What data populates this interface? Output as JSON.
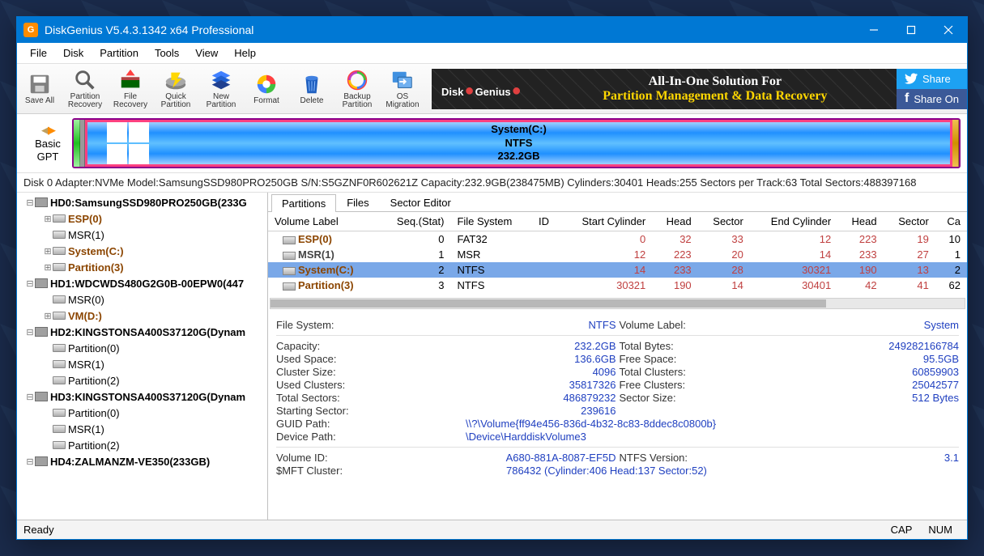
{
  "title": "DiskGenius V5.4.3.1342 x64 Professional",
  "menus": [
    "File",
    "Disk",
    "Partition",
    "Tools",
    "View",
    "Help"
  ],
  "toolbar_buttons": [
    {
      "name": "save-all",
      "label": "Save All"
    },
    {
      "name": "partition-recovery",
      "label": "Partition\nRecovery"
    },
    {
      "name": "file-recovery",
      "label": "File\nRecovery"
    },
    {
      "name": "quick-partition",
      "label": "Quick\nPartition"
    },
    {
      "name": "new-partition",
      "label": "New\nPartition"
    },
    {
      "name": "format",
      "label": "Format"
    },
    {
      "name": "delete",
      "label": "Delete"
    },
    {
      "name": "backup-partition",
      "label": "Backup\nPartition"
    },
    {
      "name": "os-migration",
      "label": "OS Migration"
    }
  ],
  "banner": {
    "title1": "Disk",
    "title2": "Genius",
    "sub1": "All-In-One Solution For",
    "sub2": "Partition Management & Data Recovery",
    "share_tw": "Share",
    "share_fb": "Share On"
  },
  "nav": {
    "l1": "Basic",
    "l2": "GPT"
  },
  "main_partition": {
    "name": "System(C:)",
    "fs": "NTFS",
    "size": "232.2GB"
  },
  "disk_info": "Disk 0 Adapter:NVMe  Model:SamsungSSD980PRO250GB  S/N:S5GZNF0R602621Z  Capacity:232.9GB(238475MB)  Cylinders:30401  Heads:255  Sectors per Track:63  Total Sectors:488397168",
  "tree": [
    {
      "d": 0,
      "exp": "-",
      "icon": "disk",
      "text": "HD0:SamsungSSD980PRO250GB(233G",
      "cls": "disk"
    },
    {
      "d": 1,
      "exp": "+",
      "icon": "part",
      "text": "ESP(0)",
      "cls": "link"
    },
    {
      "d": 1,
      "exp": "",
      "icon": "part",
      "text": "MSR(1)"
    },
    {
      "d": 1,
      "exp": "+",
      "icon": "part",
      "text": "System(C:)",
      "cls": "link"
    },
    {
      "d": 1,
      "exp": "+",
      "icon": "part",
      "text": "Partition(3)",
      "cls": "link"
    },
    {
      "d": 0,
      "exp": "-",
      "icon": "disk",
      "text": "HD1:WDCWDS480G2G0B-00EPW0(447",
      "cls": "disk"
    },
    {
      "d": 1,
      "exp": "",
      "icon": "part",
      "text": "MSR(0)"
    },
    {
      "d": 1,
      "exp": "+",
      "icon": "part",
      "text": "VM(D:)",
      "cls": "link"
    },
    {
      "d": 0,
      "exp": "-",
      "icon": "disk",
      "text": "HD2:KINGSTONSA400S37120G(Dynam",
      "cls": "disk"
    },
    {
      "d": 1,
      "exp": "",
      "icon": "part",
      "text": "Partition(0)"
    },
    {
      "d": 1,
      "exp": "",
      "icon": "part",
      "text": "MSR(1)"
    },
    {
      "d": 1,
      "exp": "",
      "icon": "part",
      "text": "Partition(2)"
    },
    {
      "d": 0,
      "exp": "-",
      "icon": "disk",
      "text": "HD3:KINGSTONSA400S37120G(Dynam",
      "cls": "disk"
    },
    {
      "d": 1,
      "exp": "",
      "icon": "part",
      "text": "Partition(0)"
    },
    {
      "d": 1,
      "exp": "",
      "icon": "part",
      "text": "MSR(1)"
    },
    {
      "d": 1,
      "exp": "",
      "icon": "part",
      "text": "Partition(2)"
    },
    {
      "d": 0,
      "exp": "-",
      "icon": "disk",
      "text": "HD4:ZALMANZM-VE350(233GB)",
      "cls": "disk"
    }
  ],
  "tabs": [
    "Partitions",
    "Files",
    "Sector Editor"
  ],
  "table_headers": [
    "Volume Label",
    "Seq.(Stat)",
    "File System",
    "ID",
    "Start Cylinder",
    "Head",
    "Sector",
    "End Cylinder",
    "Head",
    "Sector",
    "Ca"
  ],
  "table_rows": [
    {
      "label": "ESP(0)",
      "link": true,
      "seq": "0",
      "fs": "FAT32",
      "id": "",
      "sc": "0",
      "sh": "32",
      "ss": "33",
      "ec": "12",
      "eh": "223",
      "es": "19",
      "c": "10"
    },
    {
      "label": "MSR(1)",
      "link": false,
      "seq": "1",
      "fs": "MSR",
      "id": "",
      "sc": "12",
      "sh": "223",
      "ss": "20",
      "ec": "14",
      "eh": "233",
      "es": "27",
      "c": "1"
    },
    {
      "label": "System(C:)",
      "link": true,
      "seq": "2",
      "fs": "NTFS",
      "id": "",
      "sc": "14",
      "sh": "233",
      "ss": "28",
      "ec": "30321",
      "eh": "190",
      "es": "13",
      "c": "2",
      "selected": true
    },
    {
      "label": "Partition(3)",
      "link": true,
      "seq": "3",
      "fs": "NTFS",
      "id": "",
      "sc": "30321",
      "sh": "190",
      "ss": "14",
      "ec": "30401",
      "eh": "42",
      "es": "41",
      "c": "62"
    }
  ],
  "details": {
    "file_system": {
      "k": "File System:",
      "v": "NTFS"
    },
    "volume_label": {
      "k": "Volume Label:",
      "v": "System"
    },
    "capacity": {
      "k": "Capacity:",
      "v": "232.2GB"
    },
    "total_bytes": {
      "k": "Total Bytes:",
      "v": "249282166784"
    },
    "used_space": {
      "k": "Used Space:",
      "v": "136.6GB"
    },
    "free_space": {
      "k": "Free Space:",
      "v": "95.5GB"
    },
    "cluster_size": {
      "k": "Cluster Size:",
      "v": "4096"
    },
    "total_clusters": {
      "k": "Total Clusters:",
      "v": "60859903"
    },
    "used_clusters": {
      "k": "Used Clusters:",
      "v": "35817326"
    },
    "free_clusters": {
      "k": "Free Clusters:",
      "v": "25042577"
    },
    "total_sectors": {
      "k": "Total Sectors:",
      "v": "486879232"
    },
    "sector_size": {
      "k": "Sector Size:",
      "v": "512 Bytes"
    },
    "starting_sector": {
      "k": "Starting Sector:",
      "v": "239616"
    },
    "guid_path": {
      "k": "GUID Path:",
      "v": "\\\\?\\Volume{ff94e456-836d-4b32-8c83-8ddec8c0800b}"
    },
    "device_path": {
      "k": "Device Path:",
      "v": "\\Device\\HarddiskVolume3"
    },
    "volume_id": {
      "k": "Volume ID:",
      "v": "A680-881A-8087-EF5D"
    },
    "ntfs_version": {
      "k": "NTFS Version:",
      "v": "3.1"
    },
    "mft_cluster": {
      "k": "$MFT Cluster:",
      "v": "786432 (Cylinder:406 Head:137 Sector:52)"
    }
  },
  "status": {
    "ready": "Ready",
    "cap": "CAP",
    "num": "NUM"
  }
}
